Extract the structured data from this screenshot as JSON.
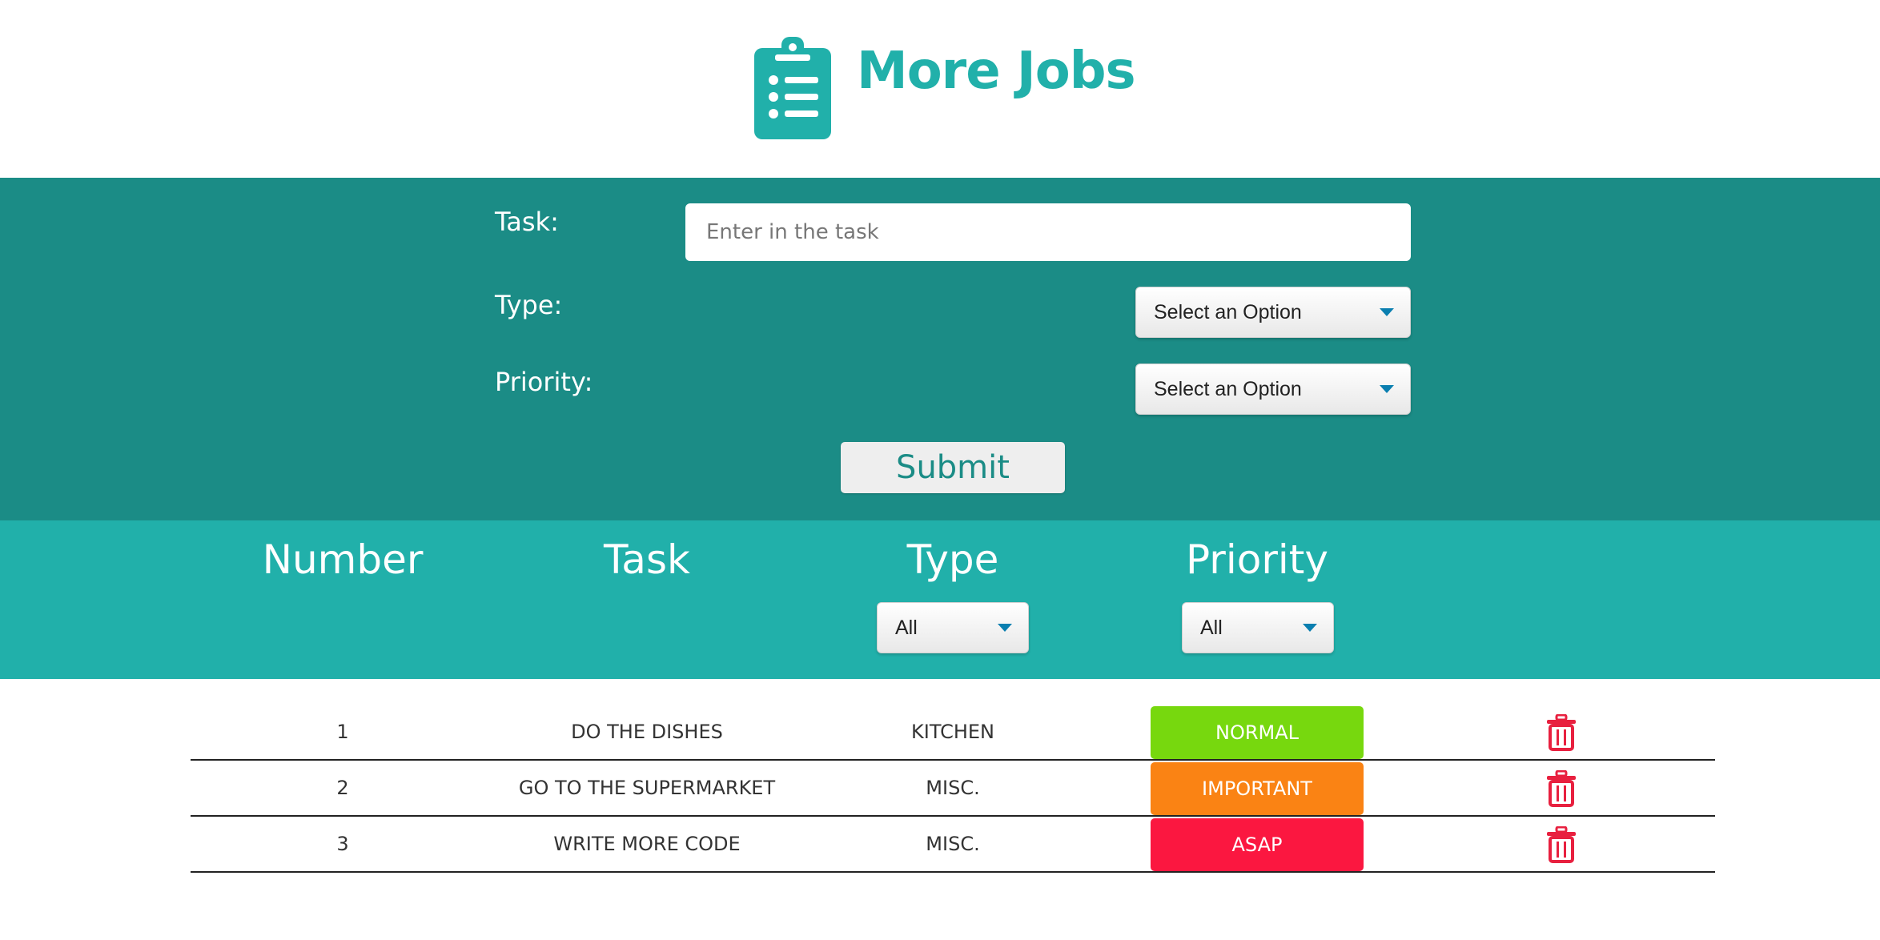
{
  "app": {
    "title": "More Jobs",
    "accent_color": "#21b0aa",
    "logo_icon": "clipboard-list-icon"
  },
  "form": {
    "task_label": "Task:",
    "task_placeholder": "Enter in the task",
    "type_label": "Type:",
    "type_select_value": "Select an Option",
    "priority_label": "Priority:",
    "priority_select_value": "Select an Option",
    "submit_label": "Submit",
    "band_color": "#1b8c86"
  },
  "table": {
    "headers": {
      "number": "Number",
      "task": "Task",
      "type": "Type",
      "priority": "Priority"
    },
    "filters": {
      "type_value": "All",
      "priority_value": "All"
    },
    "rows": [
      {
        "number": "1",
        "task": "DO THE DISHES",
        "type": "KITCHEN",
        "priority": "NORMAL",
        "priority_color": "#77d80e",
        "action_icon": "trash-icon"
      },
      {
        "number": "2",
        "task": "GO TO THE SUPERMARKET",
        "type": "MISC.",
        "priority": "IMPORTANT",
        "priority_color": "#fa8314",
        "action_icon": "trash-icon"
      },
      {
        "number": "3",
        "task": "WRITE MORE CODE",
        "type": "MISC.",
        "priority": "ASAP",
        "priority_color": "#fb1740",
        "action_icon": "trash-icon"
      }
    ],
    "delete_icon_color": "#e8203f"
  }
}
